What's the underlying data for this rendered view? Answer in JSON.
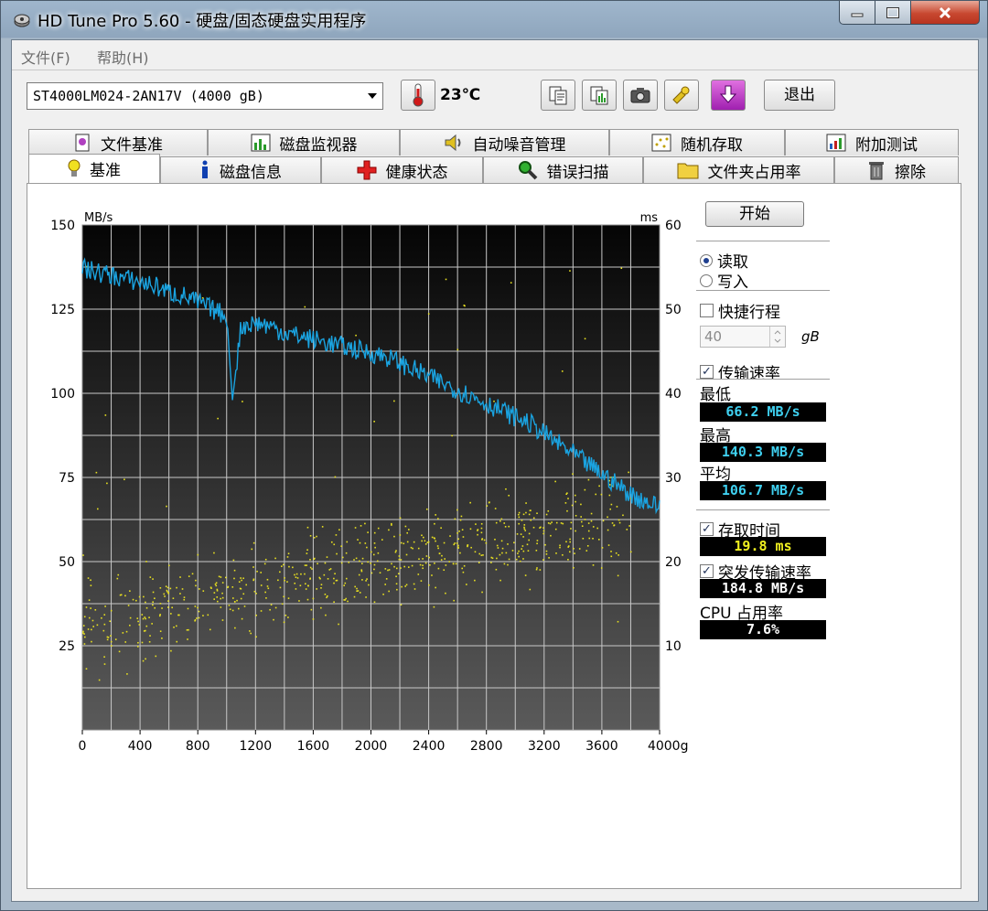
{
  "window": {
    "title": "HD Tune Pro 5.60 - 硬盘/固态硬盘实用程序",
    "controls": [
      "minimize",
      "maximize",
      "close"
    ]
  },
  "menu": {
    "file": "文件(F)",
    "help": "帮助(H)"
  },
  "toolbar": {
    "drive": "ST4000LM024-2AN17V (4000 gB)",
    "temperature": "23℃",
    "exit_label": "退出",
    "icons": [
      "copy-text-icon",
      "copy-image-icon",
      "camera-icon",
      "settings-icon",
      "download-icon"
    ]
  },
  "tabs_top": [
    {
      "label": "文件基准",
      "icon": "file-benchmark-icon"
    },
    {
      "label": "磁盘监视器",
      "icon": "disk-monitor-icon"
    },
    {
      "label": "自动噪音管理",
      "icon": "speaker-icon"
    },
    {
      "label": "随机存取",
      "icon": "random-access-icon"
    },
    {
      "label": "附加测试",
      "icon": "extra-tests-icon"
    }
  ],
  "tabs_bottom": [
    {
      "label": "基准",
      "icon": "lightbulb-icon",
      "active": true
    },
    {
      "label": "磁盘信息",
      "icon": "info-icon"
    },
    {
      "label": "健康状态",
      "icon": "health-cross-icon"
    },
    {
      "label": "错误扫描",
      "icon": "magnifier-icon"
    },
    {
      "label": "文件夹占用率",
      "icon": "folder-icon"
    },
    {
      "label": "擦除",
      "icon": "trash-icon"
    }
  ],
  "controls": {
    "start_label": "开始",
    "read_label": "读取",
    "write_label": "写入",
    "short_stroke_label": "快捷行程",
    "short_stroke_value": "40",
    "short_stroke_unit": "gB",
    "transfer_rate_label": "传输速率",
    "min_label": "最低",
    "min_value": "66.2 MB/s",
    "max_label": "最高",
    "max_value": "140.3 MB/s",
    "avg_label": "平均",
    "avg_value": "106.7 MB/s",
    "access_time_label": "存取时间",
    "access_time_value": "19.8 ms",
    "burst_rate_label": "突发传输速率",
    "burst_rate_value": "184.8 MB/s",
    "cpu_label": "CPU 占用率",
    "cpu_value": "7.6%",
    "read_selected": true,
    "short_stroke_checked": false,
    "transfer_rate_checked": true,
    "access_time_checked": true,
    "burst_rate_checked": true
  },
  "chart_data": {
    "type": "line",
    "ylabel": "MB/s",
    "y2label": "ms",
    "xlim": [
      0,
      4000
    ],
    "ylim": [
      0,
      150
    ],
    "y2lim": [
      0,
      60
    ],
    "x_ticks": [
      "0",
      "400",
      "800",
      "1200",
      "1600",
      "2000",
      "2400",
      "2800",
      "3200",
      "3600",
      "4000gB"
    ],
    "y_ticks": [
      "150",
      "125",
      "100",
      "75",
      "50",
      "25"
    ],
    "y2_ticks": [
      "60",
      "50",
      "40",
      "30",
      "20",
      "10"
    ],
    "grid": true,
    "background": "#0d0d0d",
    "series": [
      {
        "color": "#1aa3e0",
        "x": [
          0,
          100,
          200,
          300,
          400,
          500,
          600,
          700,
          800,
          900,
          1000,
          1040,
          1100,
          1200,
          1300,
          1400,
          1500,
          1600,
          1700,
          1800,
          1900,
          2000,
          2100,
          2200,
          2300,
          2400,
          2500,
          2600,
          2700,
          2800,
          2900,
          3000,
          3100,
          3200,
          3300,
          3400,
          3500,
          3600,
          3700,
          3800,
          3900,
          4000
        ],
        "y": [
          137,
          136,
          135,
          134,
          133,
          132,
          130,
          129,
          127,
          125,
          123,
          98,
          120,
          121,
          120,
          118,
          117,
          116,
          115,
          114,
          113,
          112,
          111,
          109,
          107,
          105,
          103,
          101,
          99,
          97,
          95,
          93,
          91,
          88,
          85,
          82,
          79,
          76,
          73,
          70,
          68,
          66
        ]
      }
    ],
    "access_time": {
      "color": "#e8e020",
      "unit": "ms",
      "description": "scatter of seek times, rising from about 12 ms at 0 gB to about 25 ms at 4000 gB",
      "trend_x": [
        0,
        1000,
        2000,
        3000,
        4000
      ],
      "trend_ms": [
        12,
        16,
        20,
        23,
        25
      ]
    }
  }
}
